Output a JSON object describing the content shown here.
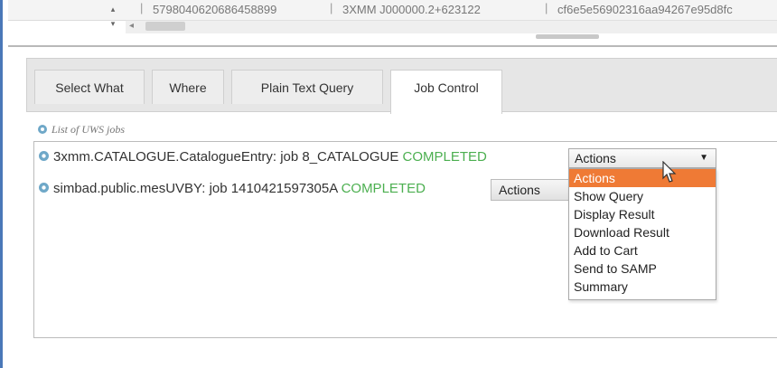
{
  "top_row": {
    "cells": [
      "5798040620686458899",
      "3XMM J000000.2+623122",
      "cf6e5e56902316aa94267e95d8fc"
    ],
    "separator": "|"
  },
  "tabs": [
    {
      "label": "Select What"
    },
    {
      "label": "Where"
    },
    {
      "label": "Plain Text Query"
    },
    {
      "label": "Job Control",
      "active": true
    }
  ],
  "uws": {
    "heading": "List of UWS jobs",
    "jobs": [
      {
        "name": "3xmm.CATALOGUE.CatalogueEntry: job 8_CATALOGUE",
        "status": "COMPLETED"
      },
      {
        "name": "simbad.public.mesUVBY: job 1410421597305A",
        "status": "COMPLETED"
      }
    ]
  },
  "actions_select": {
    "value": "Actions",
    "caret": "▼",
    "options": [
      "Actions",
      "Show Query",
      "Display Result",
      "Download Result",
      "Add to Cart",
      "Send to SAMP",
      "Summary"
    ],
    "highlighted_index": 0
  },
  "actions_button2": {
    "label": "Actions"
  },
  "colors": {
    "status": "#4caf50",
    "highlight": "#ef7a35",
    "accent_border": "#4a78b8"
  },
  "icons": {
    "job_icon": "gear-icon",
    "spinner": "up-down-arrows-icon",
    "scroll_left": "left-arrow-icon",
    "pointer": "mouse-cursor-icon"
  }
}
